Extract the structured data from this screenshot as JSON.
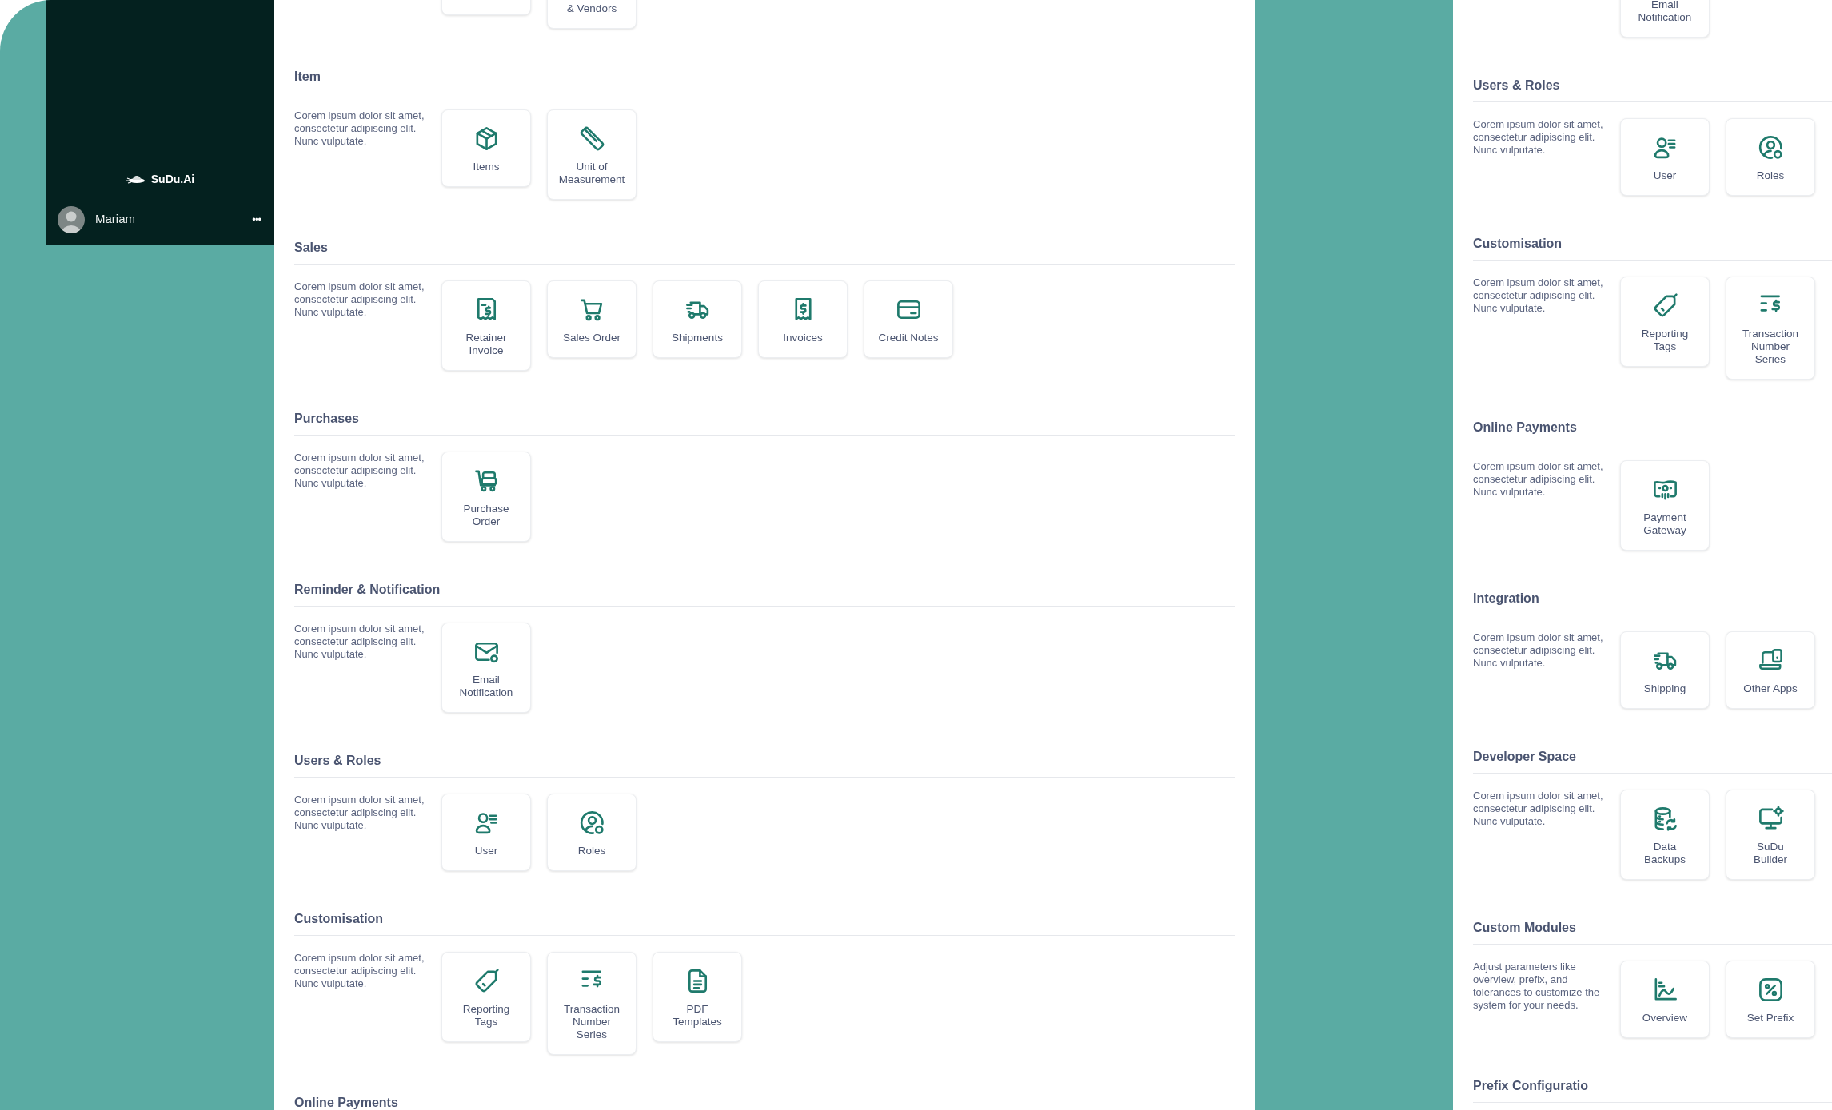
{
  "sidebar": {
    "brand": "SuDu.Ai",
    "user": {
      "name": "Mariam",
      "menu": "•••"
    }
  },
  "main_panel": {
    "top_cards": [
      {
        "kind": "blank"
      },
      {
        "kind": "tile",
        "label": "& Vendors"
      }
    ],
    "sections": [
      {
        "title": "Item",
        "description": "Corem ipsum dolor sit amet, consectetur adipiscing elit. Nunc vulputate.",
        "cards": [
          "Items",
          "Unit of\nMeasurement"
        ]
      },
      {
        "title": "Sales",
        "description": "Corem ipsum dolor sit amet, consectetur adipiscing elit. Nunc vulputate.",
        "cards": [
          "Retainer\nInvoice",
          "Sales Order",
          "Shipments",
          "Invoices",
          "Credit Notes"
        ]
      },
      {
        "title": "Purchases",
        "description": "Corem ipsum dolor sit amet, consectetur adipiscing elit. Nunc vulputate.",
        "cards": [
          "Purchase\nOrder"
        ]
      },
      {
        "title": "Reminder & Notification",
        "description": "Corem ipsum dolor sit amet, consectetur adipiscing elit. Nunc vulputate.",
        "cards": [
          "Email\nNotification"
        ]
      },
      {
        "title": "Users & Roles",
        "description": "Corem ipsum dolor sit amet, consectetur adipiscing elit. Nunc vulputate.",
        "cards": [
          "User",
          "Roles"
        ]
      },
      {
        "title": "Customisation",
        "description": "Corem ipsum dolor sit amet, consectetur adipiscing elit. Nunc vulputate.",
        "cards": [
          "Reporting\nTags",
          "Transaction\nNumber\nSeries",
          "PDF\nTemplates"
        ]
      },
      {
        "title": "Online Payments"
      }
    ]
  },
  "right_panel": {
    "top_cards": [
      {
        "kind": "tile",
        "label": "Email\nNotification"
      }
    ],
    "sections": [
      {
        "title": "Users & Roles",
        "description": "Corem ipsum dolor sit amet, consectetur adipiscing elit. Nunc vulputate.",
        "cards": [
          "User",
          "Roles"
        ]
      },
      {
        "title": "Customisation",
        "description": "Corem ipsum dolor sit amet, consectetur adipiscing elit. Nunc vulputate.",
        "cards": [
          "Reporting\nTags",
          "Transaction\nNumber\nSeries"
        ]
      },
      {
        "title": "Online Payments",
        "description": "Corem ipsum dolor sit amet, consectetur adipiscing elit. Nunc vulputate.",
        "cards": [
          "Payment\nGateway"
        ]
      },
      {
        "title": "Integration",
        "description": "Corem ipsum dolor sit amet, consectetur adipiscing elit. Nunc vulputate.",
        "cards": [
          "Shipping",
          "Other Apps"
        ]
      },
      {
        "title": "Developer Space",
        "description": "Corem ipsum dolor sit amet, consectetur adipiscing elit. Nunc vulputate.",
        "cards": [
          "Data\nBackups",
          "SuDu\nBuilder"
        ]
      },
      {
        "title": "Custom Modules",
        "description": "Adjust parameters like overview, prefix, and tolerances to customize the system for your needs.",
        "cards": [
          "Overview",
          "Set Prefix"
        ]
      },
      {
        "title": "Prefix Configuratio"
      }
    ]
  }
}
